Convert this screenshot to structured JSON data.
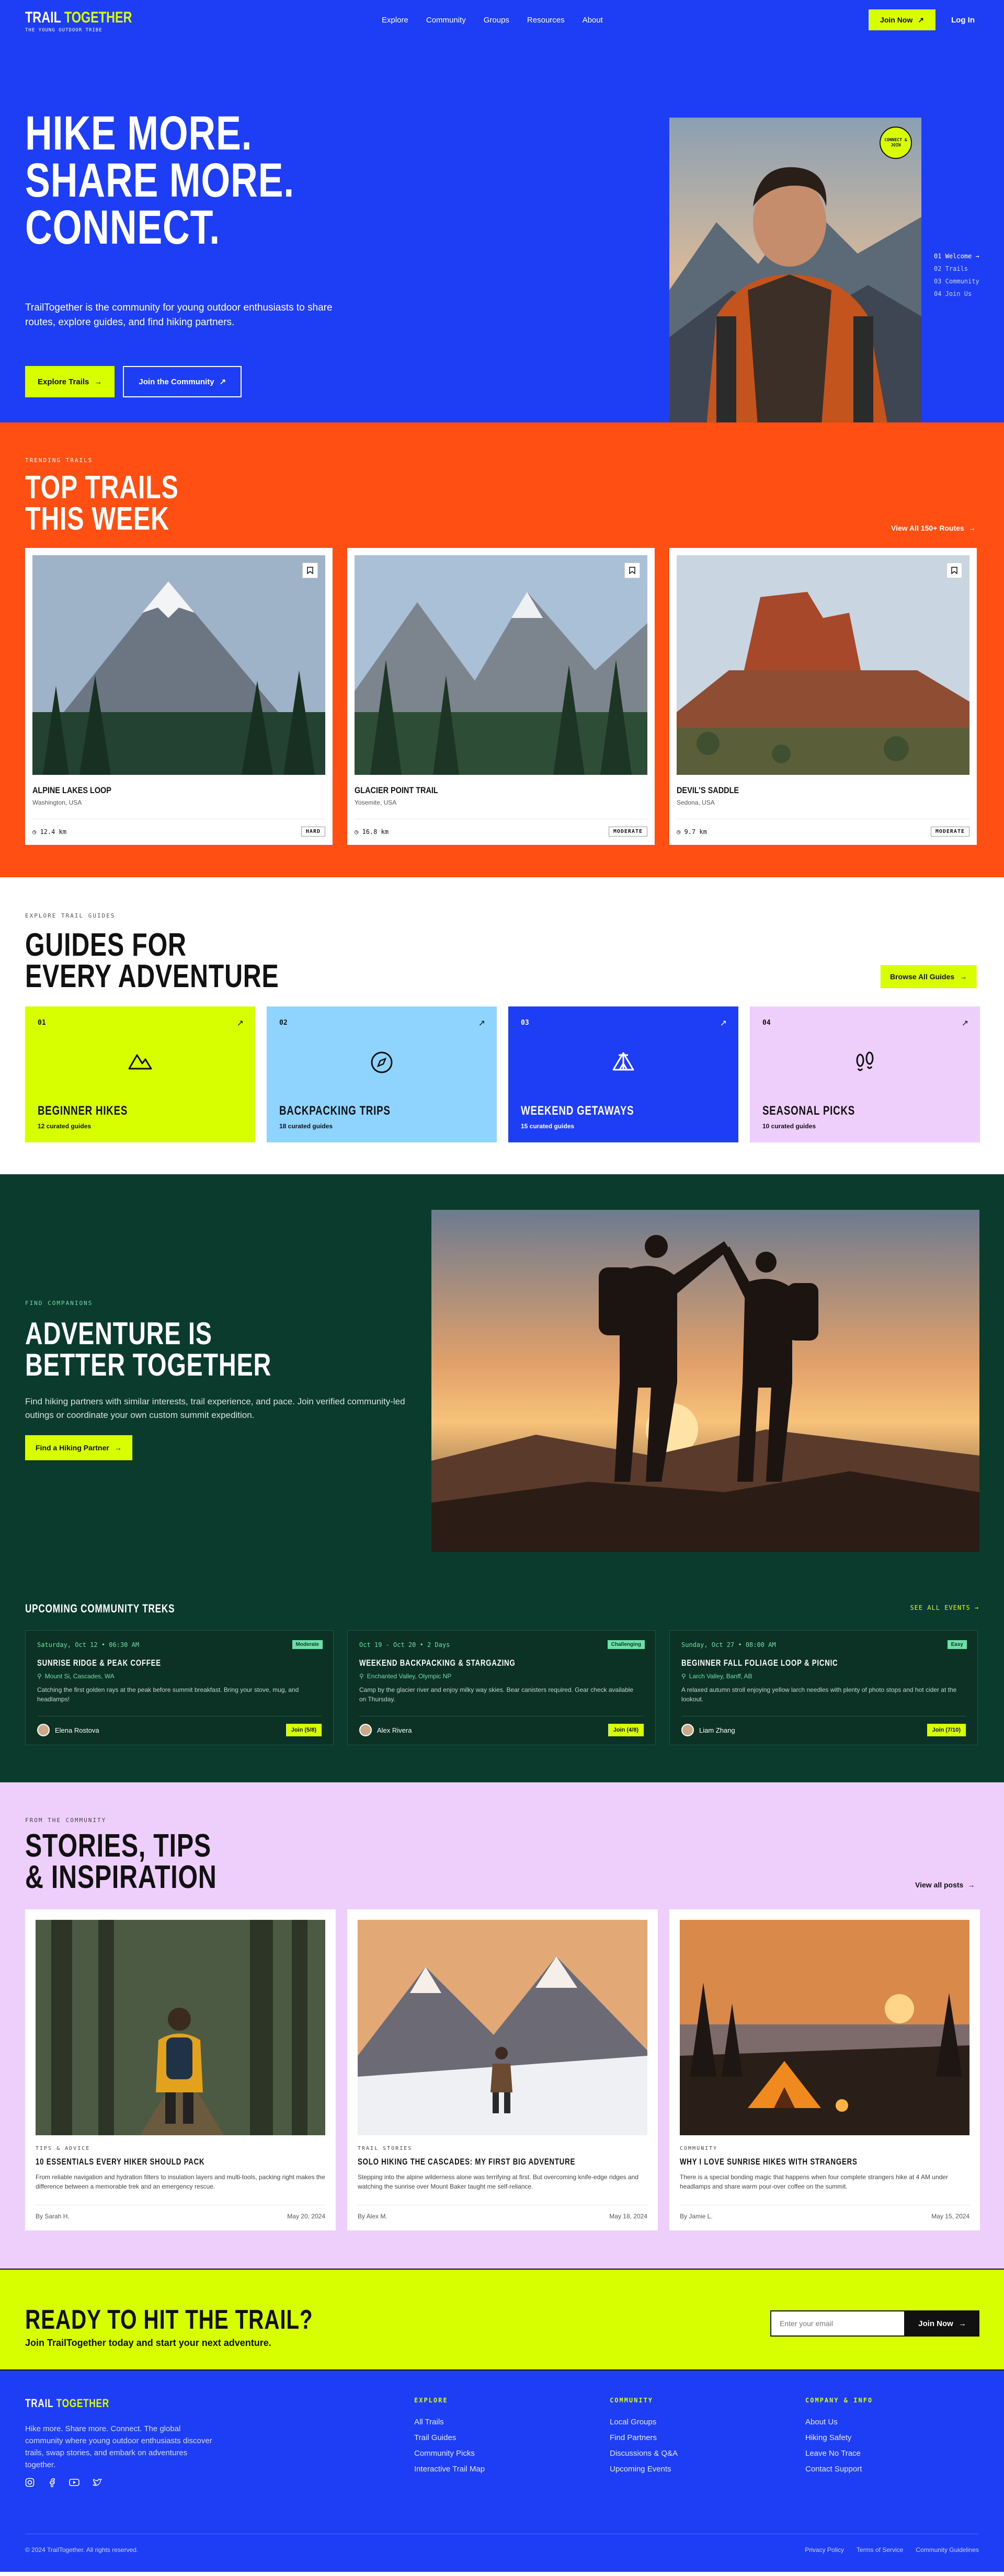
{
  "colors": {
    "brand_blue": "#1e3ef5",
    "lime": "#d8ff00",
    "orange": "#ff4f12",
    "forest": "#0b3b2c",
    "lilac": "#eecffb",
    "sky": "#8fd3ff"
  },
  "nav": {
    "brand_a": "TRAIL ",
    "brand_b": "TOGETHER",
    "tagline": "THE YOUNG OUTDOOR TRIBE",
    "links": [
      "Explore",
      "Community",
      "Groups",
      "Resources",
      "About"
    ],
    "join": "Join Now",
    "login": "Log In"
  },
  "hero": {
    "l1": "HIKE MORE.",
    "l2": "SHARE MORE.",
    "l3": "CONNECT.",
    "lead": "TrailTogether is the community for young outdoor enthusiasts to share routes, explore guides, and find hiking partners.",
    "btn_explore": "Explore Trails",
    "btn_join": "Join the Community",
    "badge": "CONNECT & JOIN",
    "list": [
      "01 Welcome →",
      "02 Trails",
      "03 Community",
      "04 Join Us"
    ]
  },
  "trails": {
    "eyebrow": "TRENDING TRAILS",
    "h_a": "TOP TRAILS",
    "h_b": "THIS WEEK",
    "view": "View All 150+ Routes",
    "items": [
      {
        "name": "ALPINE LAKES LOOP",
        "loc": "Washington, USA",
        "dist": "12.4 km",
        "diff": "HARD"
      },
      {
        "name": "GLACIER POINT TRAIL",
        "loc": "Yosemite, USA",
        "dist": "16.8 km",
        "diff": "MODERATE"
      },
      {
        "name": "DEVIL'S SADDLE",
        "loc": "Sedona, USA",
        "dist": "9.7 km",
        "diff": "MODERATE"
      }
    ]
  },
  "guides": {
    "eyebrow": "EXPLORE TRAIL GUIDES",
    "h_a": "GUIDES FOR",
    "h_b": "EVERY ADVENTURE",
    "browse": "Browse All Guides",
    "items": [
      {
        "n": "01",
        "title": "BEGINNER HIKES",
        "sub": "12 curated guides",
        "icon": "mountain-icon"
      },
      {
        "n": "02",
        "title": "BACKPACKING TRIPS",
        "sub": "18 curated guides",
        "icon": "compass-icon"
      },
      {
        "n": "03",
        "title": "WEEKEND GETAWAYS",
        "sub": "15 curated guides",
        "icon": "tent-icon"
      },
      {
        "n": "04",
        "title": "SEASONAL PICKS",
        "sub": "10 curated guides",
        "icon": "footprints-icon"
      }
    ]
  },
  "companions": {
    "eyebrow": "FIND COMPANIONS",
    "h_a": "ADVENTURE IS",
    "h_b": "BETTER TOGETHER",
    "lead": "Find hiking partners with similar interests, trail experience, and pace. Join verified community-led outings or coordinate your own custom summit expedition.",
    "btn": "Find a Hiking Partner"
  },
  "treks": {
    "title": "UPCOMING COMMUNITY TREKS",
    "see_all": "SEE ALL EVENTS →",
    "items": [
      {
        "date": "Saturday, Oct 12 • 06:30 AM",
        "level": "Moderate",
        "name": "SUNRISE RIDGE & PEAK COFFEE",
        "loc": "Mount Si, Cascades, WA",
        "desc": "Catching the first golden rays at the peak before summit breakfast. Bring your stove, mug, and headlamps!",
        "host": "Elena Rostova",
        "join": "Join (5/8)"
      },
      {
        "date": "Oct 19 - Oct 20 • 2 Days",
        "level": "Challenging",
        "name": "WEEKEND BACKPACKING & STARGAZING",
        "loc": "Enchanted Valley, Olympic NP",
        "desc": "Camp by the glacier river and enjoy milky way skies. Bear canisters required. Gear check available on Thursday.",
        "host": "Alex Rivera",
        "join": "Join (4/8)"
      },
      {
        "date": "Sunday, Oct 27 • 08:00 AM",
        "level": "Easy",
        "name": "BEGINNER FALL FOLIAGE LOOP & PICNIC",
        "loc": "Larch Valley, Banff, AB",
        "desc": "A relaxed autumn stroll enjoying yellow larch needles with plenty of photo stops and hot cider at the lookout.",
        "host": "Liam Zhang",
        "join": "Join (7/10)"
      }
    ]
  },
  "stories": {
    "eyebrow": "FROM THE COMMUNITY",
    "h_a": "STORIES, TIPS",
    "h_b": "& INSPIRATION",
    "view": "View all posts",
    "items": [
      {
        "cat": "TIPS & ADVICE",
        "title": "10 ESSENTIALS EVERY HIKER SHOULD PACK",
        "ex": "From reliable navigation and hydration filters to insulation layers and multi-tools, packing right makes the difference between a memorable trek and an emergency rescue.",
        "by": "By Sarah H.",
        "date": "May 20, 2024"
      },
      {
        "cat": "TRAIL STORIES",
        "title": "SOLO HIKING THE CASCADES: MY FIRST BIG ADVENTURE",
        "ex": "Stepping into the alpine wilderness alone was terrifying at first. But overcoming knife-edge ridges and watching the sunrise over Mount Baker taught me self-reliance.",
        "by": "By Alex M.",
        "date": "May 18, 2024"
      },
      {
        "cat": "COMMUNITY",
        "title": "WHY I LOVE SUNRISE HIKES WITH STRANGERS",
        "ex": "There is a special bonding magic that happens when four complete strangers hike at 4 AM under headlamps and share warm pour-over coffee on the summit.",
        "by": "By Jamie L.",
        "date": "May 15, 2024"
      }
    ]
  },
  "cta": {
    "title": "READY TO HIT THE TRAIL?",
    "sub": "Join TrailTogether today and start your next adventure.",
    "placeholder": "Enter your email",
    "btn": "Join Now"
  },
  "footer": {
    "brand_a": "TRAIL ",
    "brand_b": "TOGETHER",
    "desc": "Hike more. Share more. Connect. The global community where young outdoor enthusiasts discover trails, swap stories, and embark on adventures together.",
    "explore": {
      "h": "EXPLORE",
      "items": [
        "All Trails",
        "Trail Guides",
        "Community Picks",
        "Interactive Trail Map"
      ]
    },
    "community": {
      "h": "COMMUNITY",
      "items": [
        "Local Groups",
        "Find Partners",
        "Discussions & Q&A",
        "Upcoming Events"
      ]
    },
    "company": {
      "h": "COMPANY & INFO",
      "items": [
        "About Us",
        "Hiking Safety",
        "Leave No Trace",
        "Contact Support"
      ]
    },
    "copy": "© 2024 TrailTogether. All rights reserved.",
    "legal": [
      "Privacy Policy",
      "Terms of Service",
      "Community Guidelines"
    ]
  }
}
